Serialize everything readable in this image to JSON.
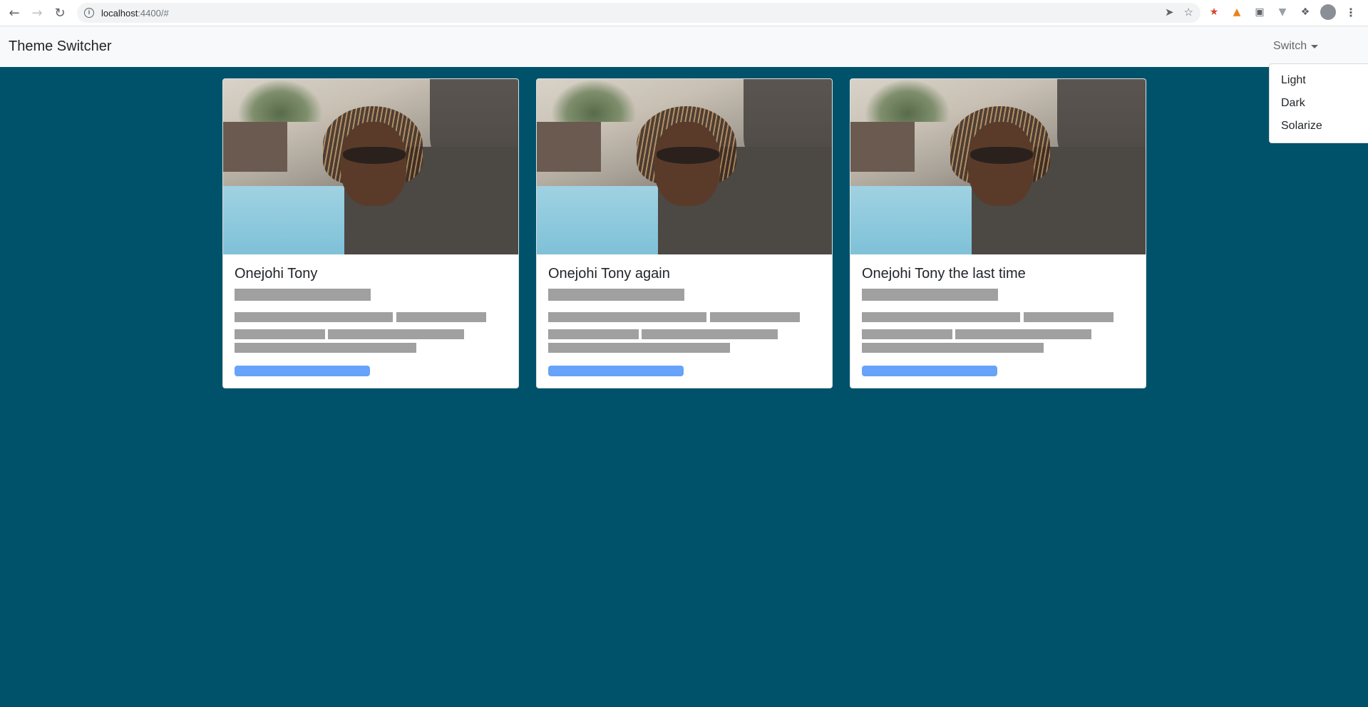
{
  "browser": {
    "url_host": "localhost",
    "url_rest": ":4400/#"
  },
  "navbar": {
    "brand": "Theme Switcher",
    "switch_label": "Switch",
    "dropdown_items": [
      "Light",
      "Dark",
      "Solarize"
    ]
  },
  "cards": [
    {
      "title": "Onejohi Tony"
    },
    {
      "title": "Onejohi Tony again"
    },
    {
      "title": "Onejohi Tony the last time"
    }
  ],
  "colors": {
    "page_background": "#00526a",
    "navbar_background": "#f8f9fa",
    "placeholder_gray": "#a0a0a0",
    "placeholder_button_blue": "#67a3f8"
  }
}
